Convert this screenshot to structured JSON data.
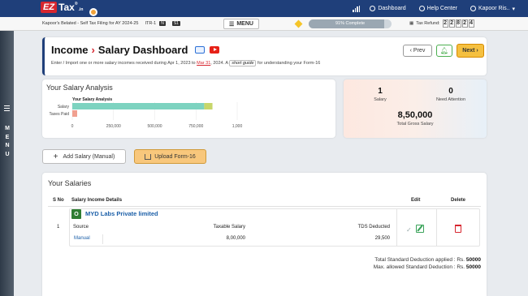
{
  "topbar": {
    "logo_ez": "EZ",
    "logo_tax": "Tax",
    "logo_reg": "®",
    "logo_in": ".in",
    "dashboard": "Dashboard",
    "help_center": "Help Center",
    "user": "Kapoor Ris..",
    "bg_color": "#1f3f7a"
  },
  "subbar": {
    "filing_text": "Kapoor's Belated - Self Tax Filing for AY 2024-25",
    "itr": "ITR-1",
    "badge_n": "N",
    "badge_s1": "S1",
    "menu": "MENU",
    "progress_text": "91% Complete",
    "progress_pct": 91,
    "refund_label": "Tax Refund:",
    "refund_digits": [
      "2",
      "2",
      "8",
      "2",
      "4"
    ]
  },
  "left_strip": {
    "vertical_text": [
      "M",
      "E",
      "N",
      "U"
    ]
  },
  "header": {
    "title_income": "Income",
    "title_arrow": "›",
    "title_page": "Salary Dashboard",
    "desc_prefix": "Enter / Import one or more salary incomes received during Apr 1, 2023 to ",
    "desc_date": "Mar 31",
    "desc_mid": ", 2024. A ",
    "desc_guide": "short guide",
    "desc_suffix": " for understanding your Form-16",
    "prev": "‹ Prev",
    "next": "Next ›"
  },
  "analysis": {
    "heading": "Your Salary Analysis",
    "chart_data": {
      "type": "bar",
      "orientation": "horizontal",
      "title": "Your Salary Analysis",
      "categories": [
        "Salary",
        "Taxes Paid"
      ],
      "series": [
        {
          "values": [
            800000,
            29500
          ],
          "colors": [
            "#7dd3c0",
            "#f0a090"
          ]
        },
        {
          "values": [
            50000,
            0
          ],
          "colors": [
            "#c7d66a",
            "#f0a090"
          ]
        }
      ],
      "xlim": [
        0,
        1000000
      ],
      "xticks": [
        "0",
        "250,000",
        "500,000",
        "750,000",
        "1,000"
      ],
      "grid": true
    }
  },
  "stats": {
    "salary_count": "1",
    "salary_label": "Salary",
    "attention_count": "0",
    "attention_label": "Need Attention",
    "gross_value": "8,50,000",
    "gross_label": "Total Gross Salary"
  },
  "actions": {
    "add_salary": "Add Salary (Manual)",
    "upload": "Upload Form-16"
  },
  "salaries": {
    "heading": "Your Salaries",
    "headers": {
      "sno": "S No",
      "details": "Salary Income Details",
      "edit": "Edit",
      "delete": "Delete"
    },
    "row": {
      "sno": "1",
      "badge": "O",
      "employer": "MYD Labs Private limited",
      "source_label": "Source",
      "source_value": "Manual",
      "taxable_label": "Taxable Salary",
      "taxable_value": "8,00,000",
      "tds_label": "TDS Deducted",
      "tds_value": "29,500"
    },
    "std_applied_label": "Total Standard Deduction applied : Rs. ",
    "std_applied_value": "50000",
    "std_max_label": "Max. allowed Standard Deduction : Rs. ",
    "std_max_value": "50000"
  }
}
